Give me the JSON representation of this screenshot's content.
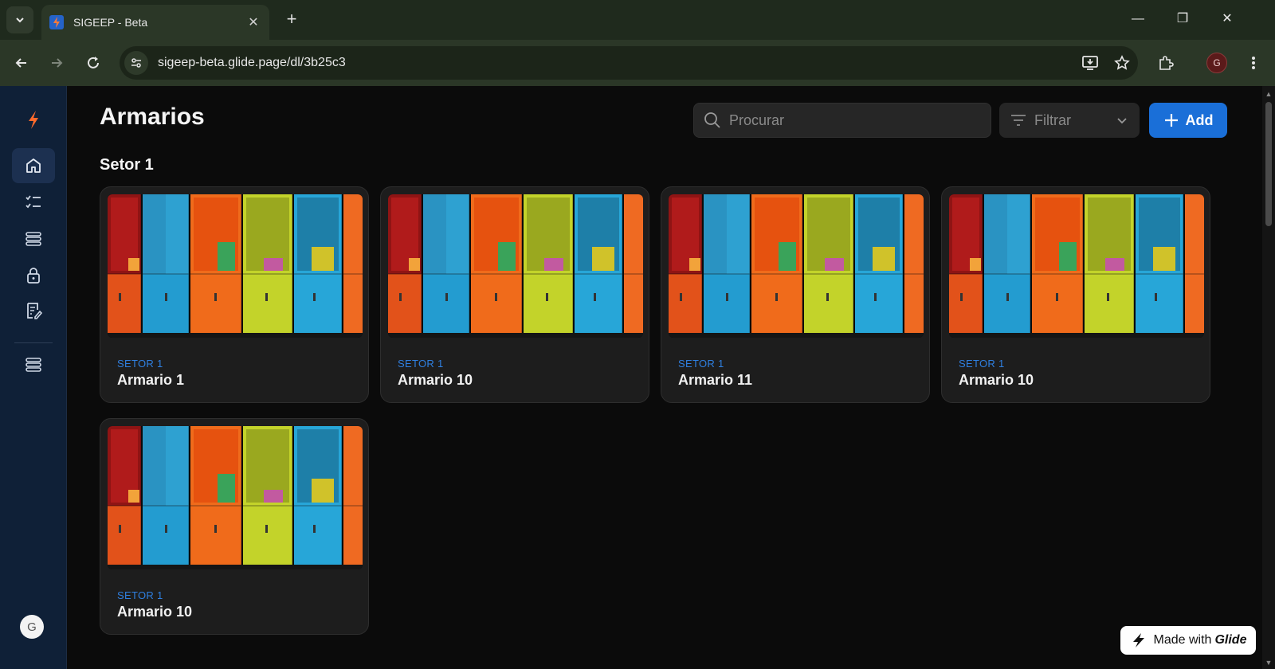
{
  "browser": {
    "tab_title": "SIGEEP - Beta",
    "url": "sigeep-beta.glide.page/dl/3b25c3",
    "profile_initial": "G"
  },
  "sidebar": {
    "items": [
      {
        "name": "home",
        "icon": "home-icon"
      },
      {
        "name": "checklist",
        "icon": "checklist-icon"
      },
      {
        "name": "stack",
        "icon": "stack-icon"
      },
      {
        "name": "lock",
        "icon": "lock-icon"
      },
      {
        "name": "form",
        "icon": "form-icon"
      },
      {
        "name": "stack-2",
        "icon": "stack-icon"
      }
    ],
    "avatar_initial": "G"
  },
  "page": {
    "title": "Armarios",
    "search_placeholder": "Procurar",
    "filter_label": "Filtrar",
    "add_label": "Add",
    "section_title": "Setor 1"
  },
  "cards": [
    {
      "subtitle": "SETOR 1",
      "title": "Armario 1"
    },
    {
      "subtitle": "SETOR 1",
      "title": "Armario 10"
    },
    {
      "subtitle": "SETOR 1",
      "title": "Armario 11"
    },
    {
      "subtitle": "SETOR 1",
      "title": "Armario 10"
    },
    {
      "subtitle": "SETOR 1",
      "title": "Armario 10"
    }
  ],
  "badge": {
    "prefix": "Made with",
    "brand": "Glide"
  },
  "colors": {
    "accent": "#1a6fd8",
    "sidebar_bg": "#0f2037",
    "card_bg": "#1d1d1d",
    "subtitle": "#2f7fe0"
  }
}
